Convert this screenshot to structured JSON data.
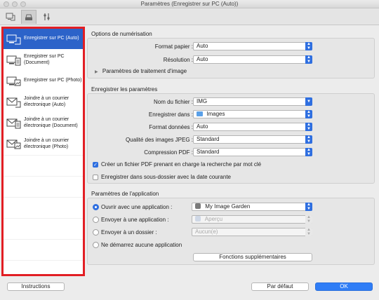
{
  "window": {
    "title": "Paramètres (Enregistrer sur PC (Auto))"
  },
  "toolbar": {
    "tabs": [
      "scan-from-computer",
      "scan-from-operation-panel",
      "general-settings"
    ]
  },
  "sidebar": {
    "items": [
      {
        "label": "Enregistrer sur PC (Auto)",
        "icon": "computer-auto-icon",
        "selected": true
      },
      {
        "label": "Enregistrer sur PC (Document)",
        "icon": "computer-document-icon",
        "selected": false
      },
      {
        "label": "Enregistrer sur PC (Photo)",
        "icon": "computer-photo-icon",
        "selected": false
      },
      {
        "label": "Joindre à un courrier électronique (Auto)",
        "icon": "email-auto-icon",
        "selected": false
      },
      {
        "label": "Joindre à un courrier électronique (Document)",
        "icon": "email-document-icon",
        "selected": false
      },
      {
        "label": "Joindre à un courrier électronique (Photo)",
        "icon": "email-photo-icon",
        "selected": false
      }
    ]
  },
  "scan_options": {
    "title": "Options de numérisation",
    "paper_size_label": "Format papier :",
    "paper_size_value": "Auto",
    "resolution_label": "Résolution :",
    "resolution_value": "Auto",
    "image_processing_label": "Paramètres de traitement d'image"
  },
  "save_settings": {
    "title": "Enregistrer les paramètres",
    "filename_label": "Nom du fichier :",
    "filename_value": "IMG",
    "save_in_label": "Enregistrer dans :",
    "save_in_value": "Images",
    "data_format_label": "Format données :",
    "data_format_value": "Auto",
    "jpeg_quality_label": "Qualité des images JPEG :",
    "jpeg_quality_value": "Standard",
    "pdf_compression_label": "Compression PDF :",
    "pdf_compression_value": "Standard",
    "searchable_pdf_label": "Créer un fichier PDF prenant en charge la recherche par mot clé",
    "searchable_pdf_checked": true,
    "subfolder_label": "Enregistrer dans sous-dossier avec la date courante",
    "subfolder_checked": false
  },
  "app_settings": {
    "title": "Paramètres de l'application",
    "open_with_label": "Ouvrir avec une application :",
    "open_with_value": "My Image Garden",
    "send_to_app_label": "Envoyer à une application :",
    "send_to_app_value": "Aperçu",
    "send_to_folder_label": "Envoyer à un dossier :",
    "send_to_folder_value": "Aucun(e)",
    "no_app_label": "Ne démarrez aucune application",
    "more_functions_label": "Fonctions supplémentaires"
  },
  "footer": {
    "instructions_label": "Instructions",
    "defaults_label": "Par défaut",
    "ok_label": "OK"
  }
}
